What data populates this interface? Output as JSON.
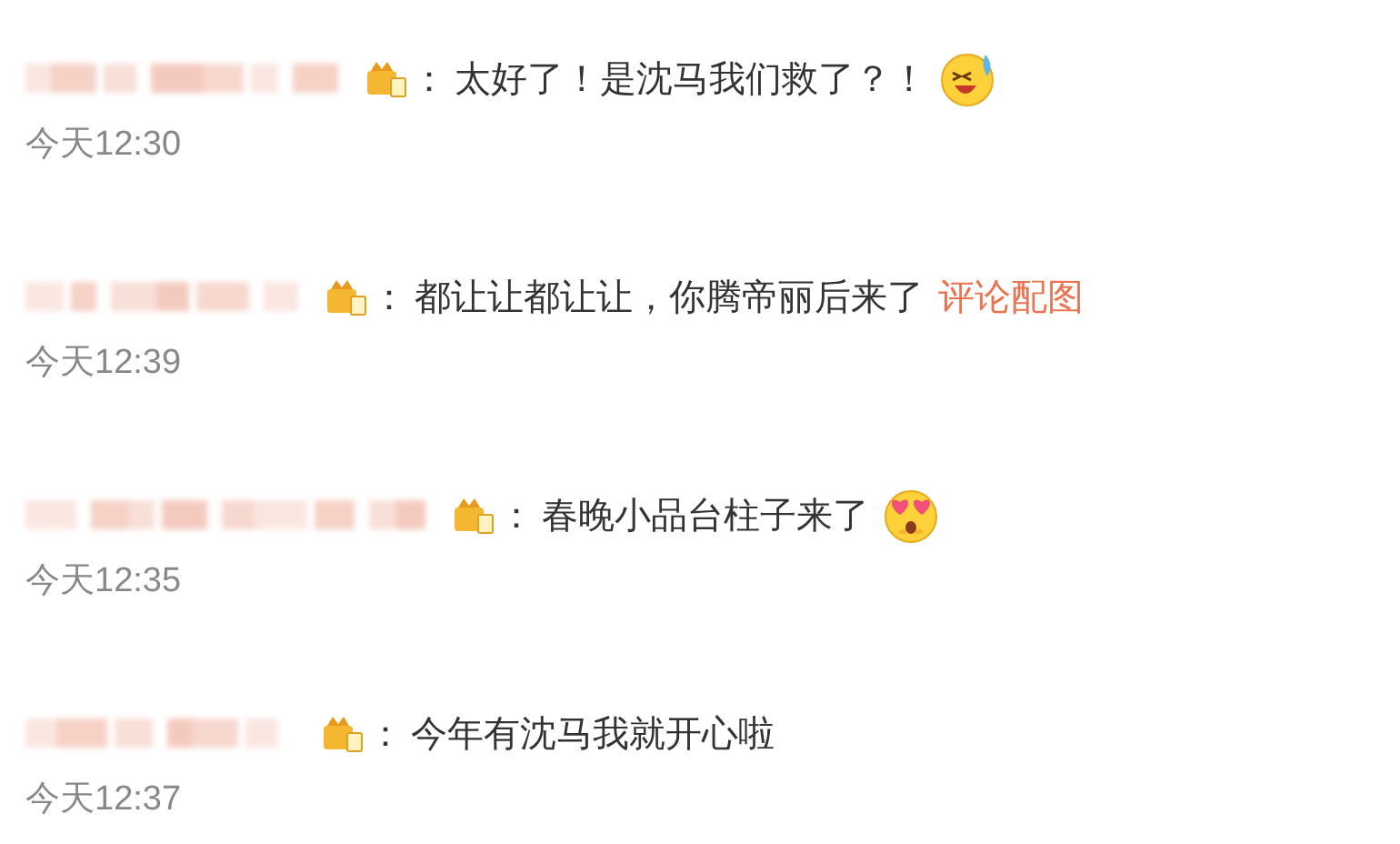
{
  "comments": [
    {
      "separator": "：",
      "text": "太好了！是沈马我们救了？！",
      "emoji": {
        "kind": "laughing"
      },
      "time": "今天12:30"
    },
    {
      "separator": "：",
      "text": "都让让都让让，你腾帝丽后来了",
      "link": "评论配图",
      "time": "今天12:39"
    },
    {
      "separator": "：",
      "text": "春晚小品台柱子来了",
      "emoji": {
        "kind": "heart-eyes"
      },
      "time": "今天12:35"
    },
    {
      "separator": "：",
      "text": "今年有沈马我就开心啦",
      "time": "今天12:37"
    }
  ]
}
